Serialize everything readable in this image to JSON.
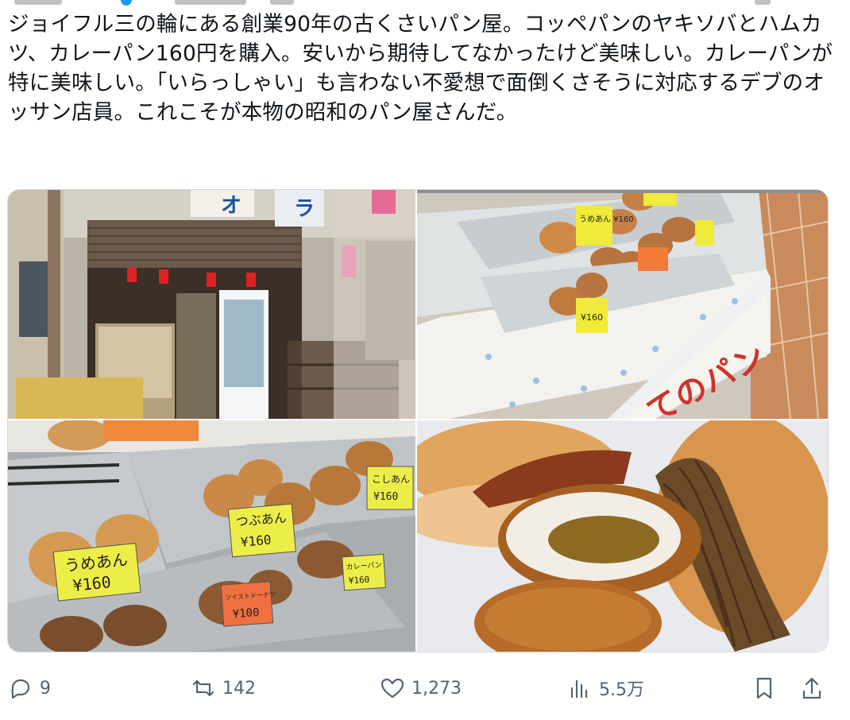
{
  "tweet": {
    "text": "ジョイフル三の輪にある創業90年の古くさいパン屋。コッペパンのヤキソバとハムカツ、カレーパン160円を購入。安いから期待してなかったけど美味しい。カレーパンが特に美味しい。「いらっしゃい」も言わない不愛想で面倒くさそうに対応するデブのオッサン店員。これこそが本物の昭和のパン屋さんだ。"
  },
  "media": {
    "photo1": {
      "sign_left": "オ",
      "sign_right": "ラ"
    },
    "photo2": {
      "price_tag_1": "うめあん ¥160",
      "price_tag_2": "¥160",
      "case_text": "てのパン"
    },
    "photo3": {
      "tag_umean": "うめあん",
      "tag_umean_price": "¥160",
      "tag_tsubuan": "つぶあん",
      "tag_tsubuan_price": "¥160",
      "tag_koshian": "こしあん",
      "tag_koshian_price": "¥160",
      "tag_curry": "カレーパン",
      "tag_curry_price": "¥160",
      "tag_donut": "ツイストドーナツ",
      "tag_donut_price": "¥100"
    },
    "photo4": {}
  },
  "actions": {
    "reply_count": "9",
    "retweet_count": "142",
    "like_count": "1,273",
    "views_count": "5.5万"
  },
  "colors": {
    "text": "#0f1419",
    "muted": "#536471",
    "border": "#cfd9de",
    "accent": "#1d9bf0"
  }
}
